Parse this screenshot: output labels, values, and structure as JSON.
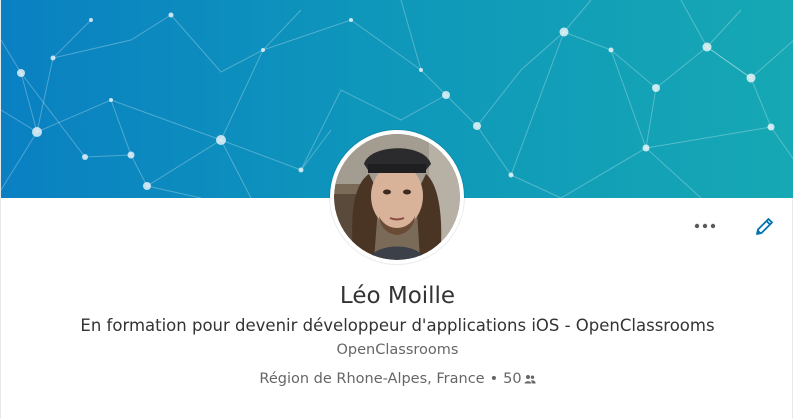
{
  "profile": {
    "name": "Léo Moille",
    "headline": "En formation pour devenir développeur d'applications iOS - OpenClassrooms",
    "company": "OpenClassrooms",
    "location": "Région de Rhone-Alpes, France",
    "separator": "•",
    "connections": "50"
  },
  "actions": {
    "more_label": "···"
  },
  "icons": {
    "more": "ellipsis-icon",
    "edit": "pencil-icon",
    "connections": "people-icon"
  },
  "colors": {
    "banner_start": "#0a80c2",
    "banner_end": "#16a8b4",
    "accent": "#0073b1"
  }
}
